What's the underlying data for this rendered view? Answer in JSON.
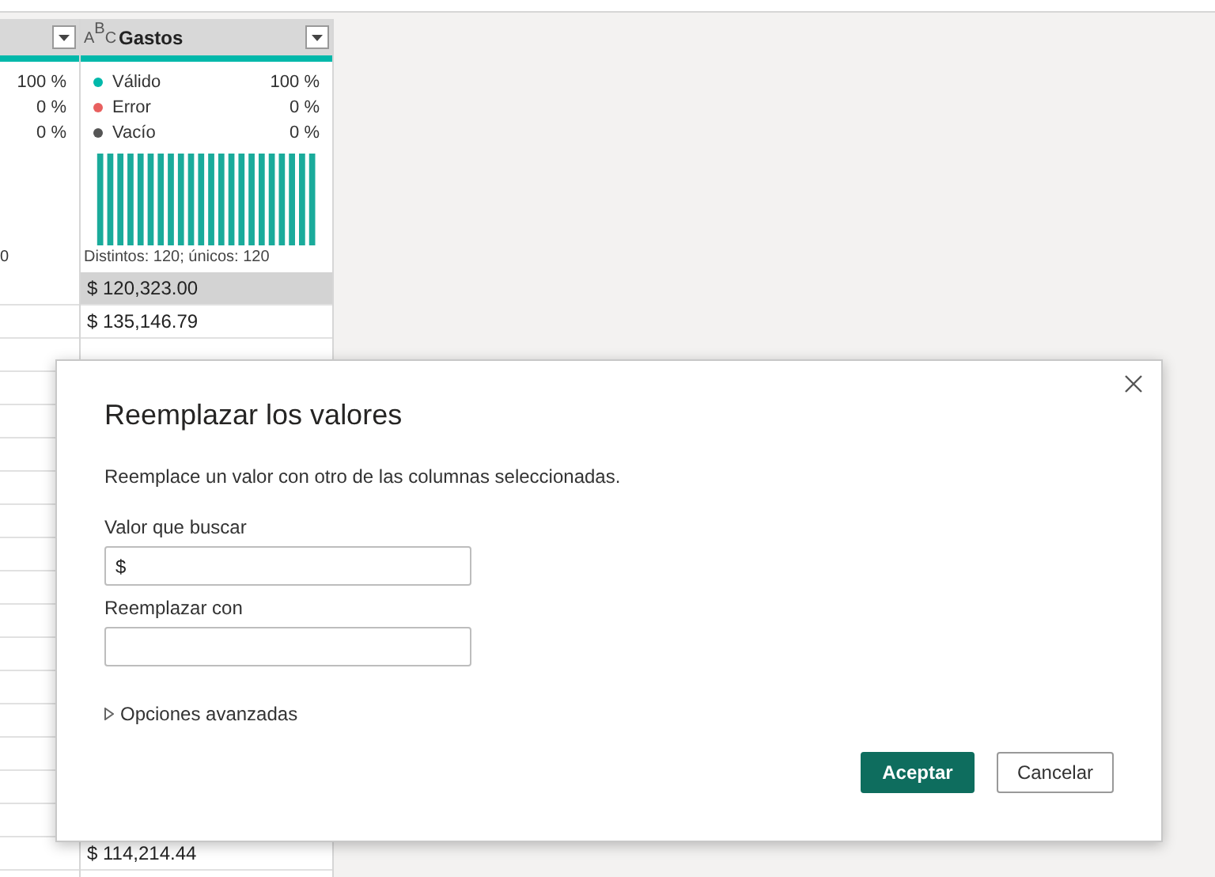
{
  "grid": {
    "column_1": {
      "quality": [
        {
          "value": "100 %"
        },
        {
          "value": "0 %"
        },
        {
          "value": "0 %"
        }
      ],
      "distinct": "0"
    },
    "gastos": {
      "header": "Gastos",
      "type_glyphs": [
        "A",
        "B",
        "C"
      ],
      "quality": [
        {
          "label": "Válido",
          "value": "100 %",
          "color": "#01b8aa"
        },
        {
          "label": "Error",
          "value": "0 %",
          "color": "#e8605f"
        },
        {
          "label": "Vacío",
          "value": "0 %",
          "color": "#555555"
        }
      ],
      "distinct": "Distintos: 120; únicos: 120",
      "rows_top": [
        {
          "value": "$ 120,323.00",
          "selected": true
        },
        {
          "value": "$ 135,146.79",
          "selected": false
        }
      ],
      "rows_bottom": [
        {
          "value": "$ 114,214.44",
          "selected": false
        }
      ]
    }
  },
  "dialog": {
    "title": "Reemplazar los valores",
    "description": "Reemplace un valor con otro de las columnas seleccionadas.",
    "fields": [
      {
        "label": "Valor que buscar",
        "value": "$"
      },
      {
        "label": "Reemplazar con"
      }
    ],
    "advanced": {
      "label": "Opciones avanzadas",
      "expanded": false
    },
    "buttons": [
      {
        "label": "Aceptar",
        "kind": "primary"
      },
      {
        "label": "Cancelar",
        "kind": "secondary"
      }
    ]
  }
}
